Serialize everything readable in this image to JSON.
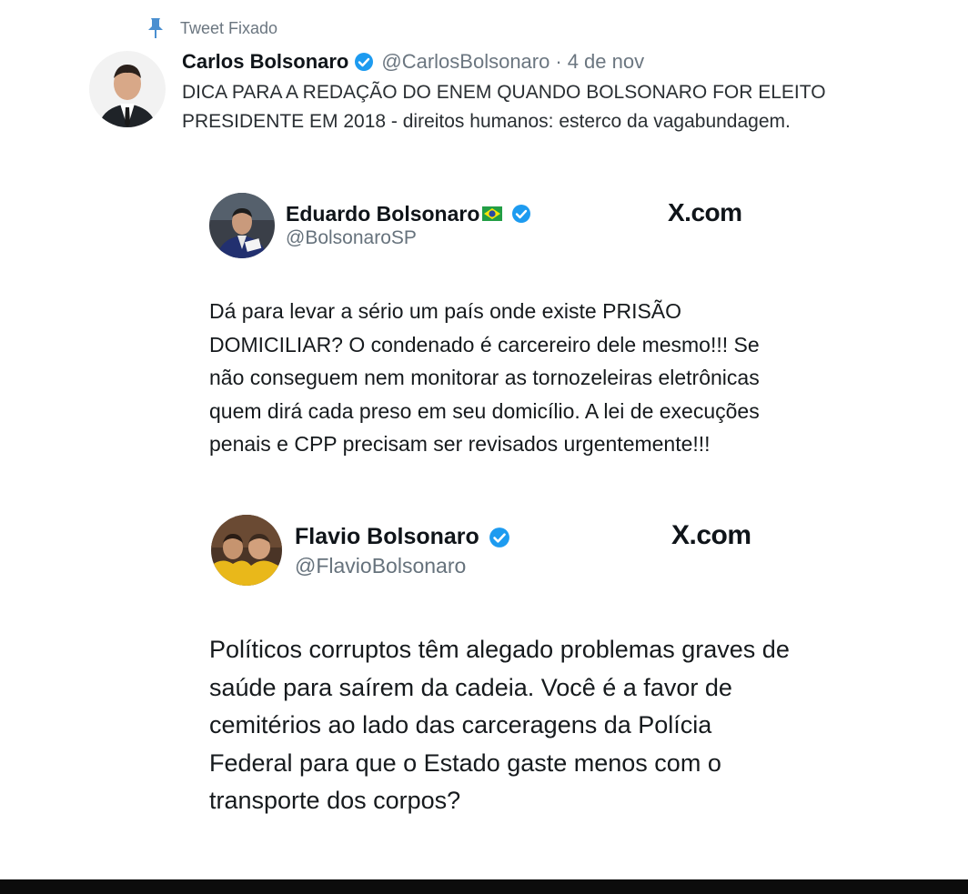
{
  "pinned": {
    "label": "Tweet Fixado",
    "icon": "pin-icon"
  },
  "carlos": {
    "name": "Carlos Bolsonaro",
    "handle": "@CarlosBolsonaro",
    "separator": "·",
    "date": "4 de nov",
    "text": "DICA PARA A REDAÇÃO DO ENEM QUANDO BOLSONARO FOR ELEITO PRESIDENTE EM 2018 - direitos humanos: esterco da vagabundagem.",
    "verified": true
  },
  "eduardo": {
    "name": "Eduardo Bolsonaro",
    "flag_icon": "brazil-flag-icon",
    "handle": "@BolsonaroSP",
    "source": "X.com",
    "text": "Dá para levar a sério um país onde existe PRISÃO DOMICILIAR? O condenado é carcereiro dele mesmo!!! Se não conseguem nem monitorar as tornozeleiras eletrônicas quem dirá cada preso em seu domicílio. A lei de execuções penais e CPP precisam ser revisados urgentemente!!!",
    "verified": true
  },
  "flavio": {
    "name": "Flavio Bolsonaro",
    "handle": "@FlavioBolsonaro",
    "source": "X.com",
    "text": "Políticos corruptos têm alegado problemas graves de saúde para saírem da cadeia. Você é a favor de cemitérios ao lado das carceragens da Polícia Federal para que o Estado gaste menos com o transporte dos corpos?",
    "verified": true
  },
  "colors": {
    "verified_blue": "#1d9bf0",
    "text_primary": "#0f1419",
    "text_secondary": "#6b7680",
    "pin_blue": "#4a8fd0"
  }
}
